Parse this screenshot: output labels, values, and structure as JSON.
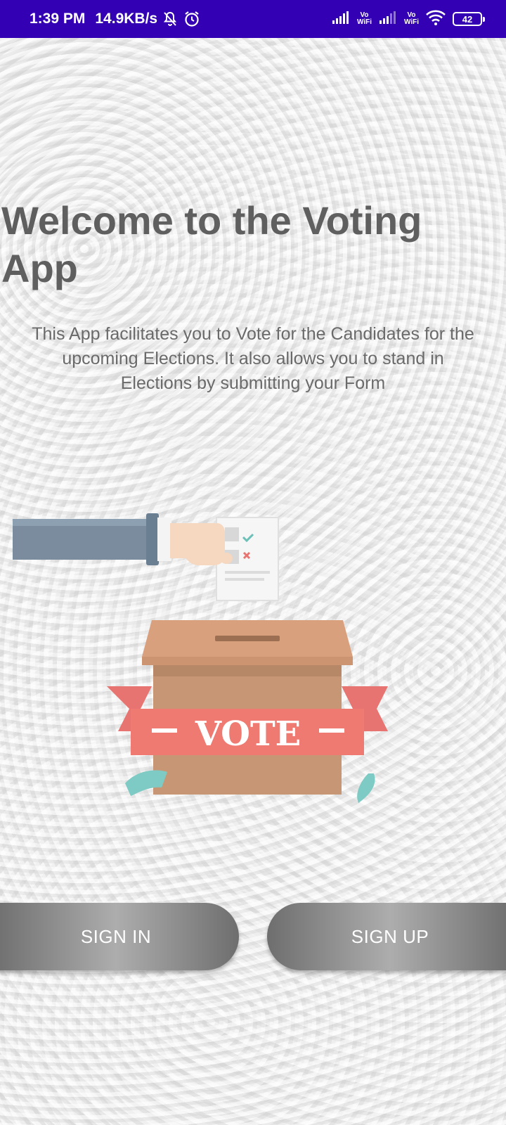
{
  "status_bar": {
    "time": "1:39 PM",
    "network_speed": "14.9KB/s",
    "vowifi_top": "Vo",
    "vowifi_bottom": "WiFi",
    "battery_level": "42",
    "background_color": "#3300b3",
    "icons": [
      "mute-bell-icon",
      "alarm-icon",
      "signal-icon",
      "vowifi-icon",
      "signal-icon",
      "vowifi-icon",
      "wifi-icon",
      "battery-icon"
    ]
  },
  "welcome": {
    "title": "Welcome to the Voting App",
    "description": "This App facilitates you to Vote for the Candidates for the upcoming Elections. It also allows you to stand in Elections by submitting your Form"
  },
  "illustration": {
    "banner_text": "VOTE"
  },
  "buttons": {
    "sign_in": "SIGN IN",
    "sign_up": "SIGN UP"
  }
}
